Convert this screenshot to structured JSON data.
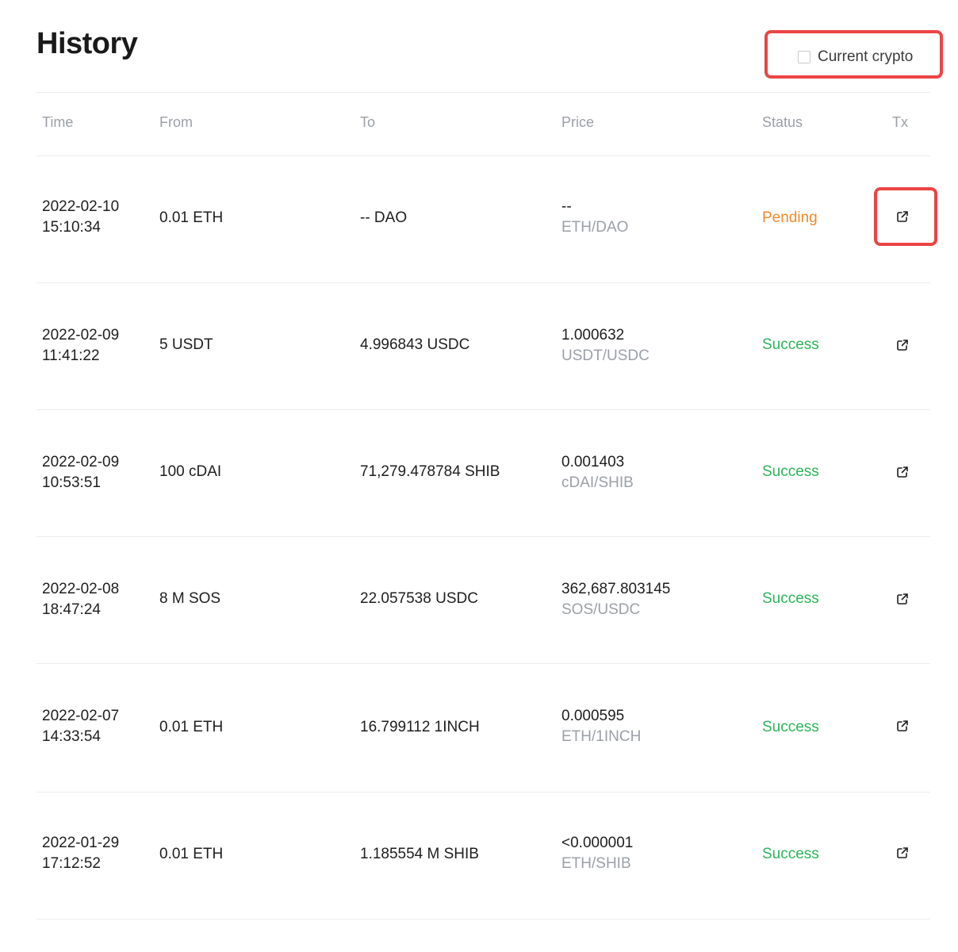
{
  "page": {
    "title": "History"
  },
  "filter": {
    "label": "Current crypto",
    "checked": false
  },
  "table": {
    "headers": {
      "time": "Time",
      "from": "From",
      "to": "To",
      "price": "Price",
      "status": "Status",
      "tx": "Tx"
    },
    "rows": [
      {
        "date": "2022-02-10",
        "time": "15:10:34",
        "from": "0.01 ETH",
        "to": "-- DAO",
        "price": "--",
        "pair": "ETH/DAO",
        "status": "Pending",
        "status_kind": "pending"
      },
      {
        "date": "2022-02-09",
        "time": "11:41:22",
        "from": "5 USDT",
        "to": "4.996843 USDC",
        "price": "1.000632",
        "pair": "USDT/USDC",
        "status": "Success",
        "status_kind": "success"
      },
      {
        "date": "2022-02-09",
        "time": "10:53:51",
        "from": "100 cDAI",
        "to": "71,279.478784 SHIB",
        "price": "0.001403",
        "pair": "cDAI/SHIB",
        "status": "Success",
        "status_kind": "success"
      },
      {
        "date": "2022-02-08",
        "time": "18:47:24",
        "from": "8 M SOS",
        "to": "22.057538 USDC",
        "price": "362,687.803145",
        "pair": "SOS/USDC",
        "status": "Success",
        "status_kind": "success"
      },
      {
        "date": "2022-02-07",
        "time": "14:33:54",
        "from": "0.01 ETH",
        "to": "16.799112 1INCH",
        "price": "0.000595",
        "pair": "ETH/1INCH",
        "status": "Success",
        "status_kind": "success"
      },
      {
        "date": "2022-01-29",
        "time": "17:12:52",
        "from": "0.01 ETH",
        "to": "1.185554 M SHIB",
        "price": "<0.000001",
        "pair": "ETH/SHIB",
        "status": "Success",
        "status_kind": "success"
      }
    ]
  },
  "icons": {
    "tx": "external-link-icon"
  },
  "colors": {
    "pending": "#f28a2a",
    "success": "#2db45a",
    "muted": "#9ba0a7",
    "highlight": "#eb4444"
  }
}
